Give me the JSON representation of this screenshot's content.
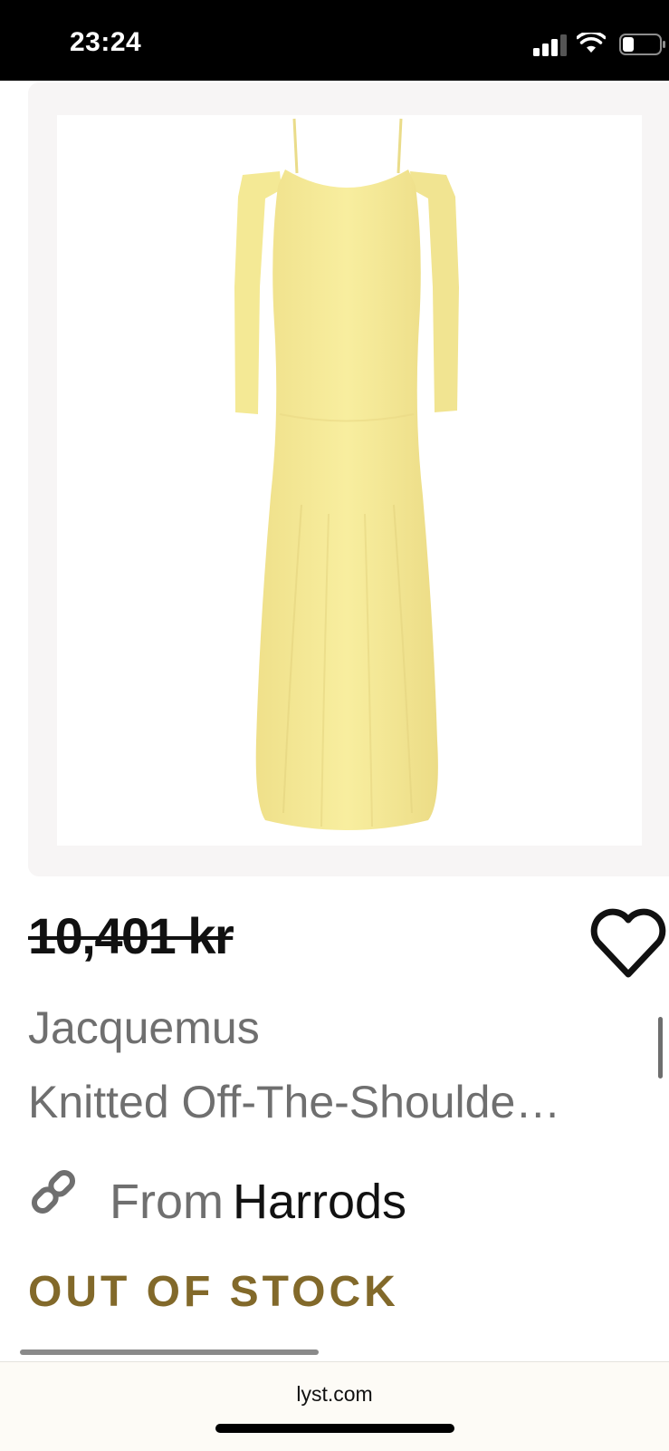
{
  "status_bar": {
    "time": "23:24",
    "icons": [
      "signal-icon",
      "wifi-icon",
      "battery-icon"
    ]
  },
  "product": {
    "image_icon": "yellow-dress-image",
    "price_original": "10,401 kr",
    "brand": "Jacquemus",
    "title": "Knitted Off-The-Shoulde…",
    "retailer_prefix": "From",
    "retailer_name": "Harrods",
    "stock_status": "OUT OF STOCK"
  },
  "browser": {
    "url": "lyst.com"
  },
  "colors": {
    "stock_status": "#82692a",
    "dress": "#f7ec9a",
    "card_background": "#f7f5f5"
  }
}
